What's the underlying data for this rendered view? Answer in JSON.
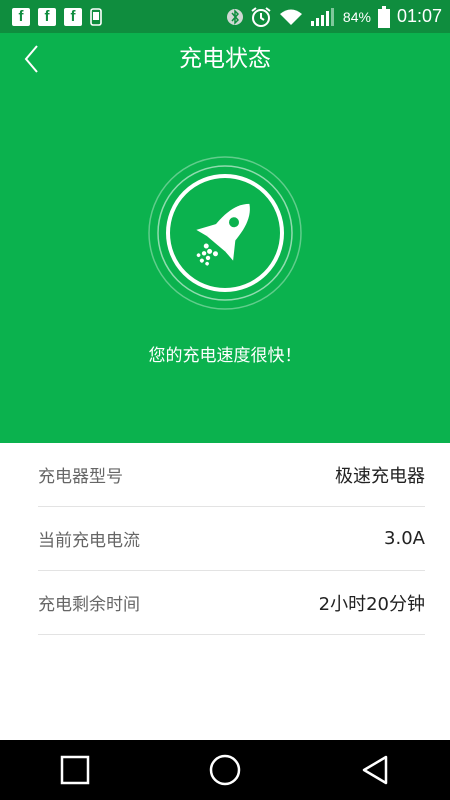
{
  "status_bar": {
    "left_icons": [
      "facebook-icon",
      "facebook-icon",
      "facebook-icon",
      "phone-icon"
    ],
    "battery_percent": "84%",
    "time": "01:07",
    "fb_letter": "f"
  },
  "header": {
    "title": "充电状态"
  },
  "hero": {
    "message": "您的充电速度很快！",
    "icon": "rocket-icon"
  },
  "info": {
    "rows": [
      {
        "label": "充电器型号",
        "value": "极速充电器"
      },
      {
        "label": "当前充电电流",
        "value": "3.0A"
      },
      {
        "label": "充电剩余时间",
        "value": "2小时20分钟"
      }
    ]
  },
  "colors": {
    "status_bar": "#0f8d3e",
    "brand_green": "#0bb24e",
    "divider": "#e3e3e3"
  }
}
